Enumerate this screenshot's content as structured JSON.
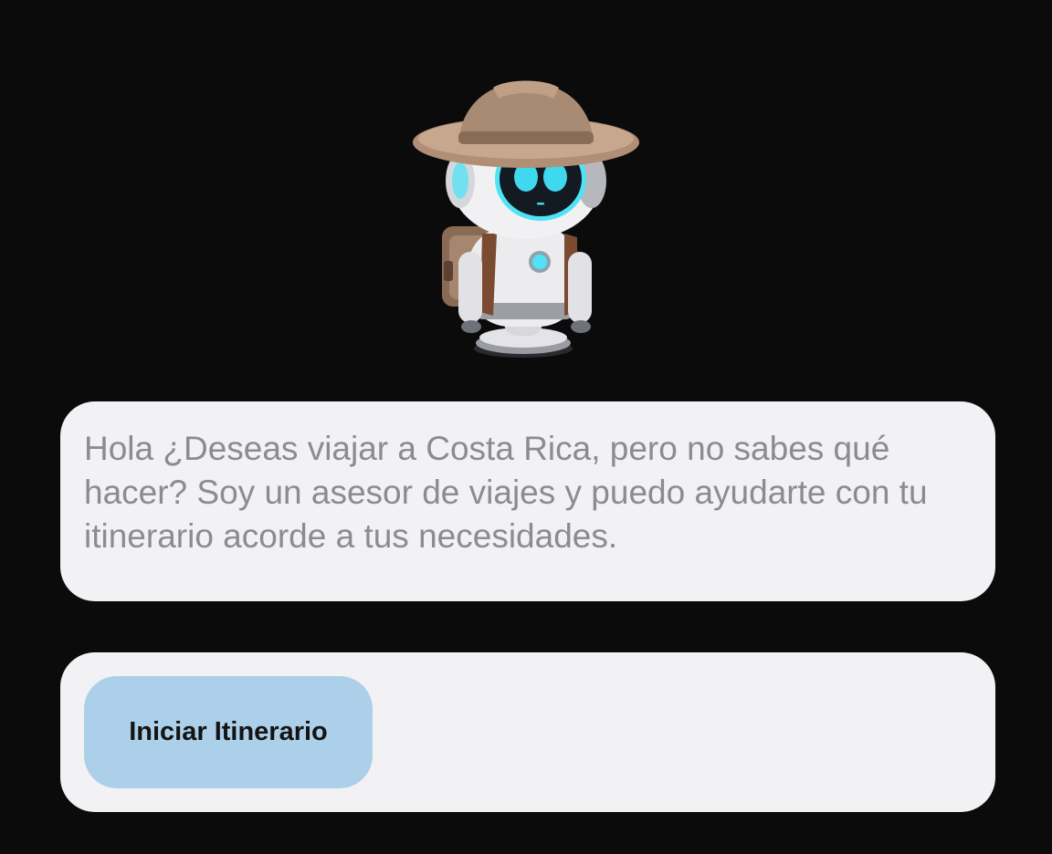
{
  "mascot": {
    "icon": "explorer-robot-icon",
    "colors": {
      "hat": "#a98a72",
      "eye_glow": "#4fe3f5",
      "body": "#e9e9ec",
      "backpack": "#7a4b31"
    }
  },
  "message": {
    "text": "Hola ¿Deseas viajar a Costa Rica, pero no sabes qué hacer? Soy un asesor de viajes y puedo ayudarte con tu itinerario acorde a tus necesidades."
  },
  "actions": {
    "start_label": "Iniciar Itinerario"
  },
  "colors": {
    "background": "#0b0b0c",
    "card": "#f2f2f4",
    "button": "#acd0e9",
    "message_text": "#8c8c8e"
  }
}
